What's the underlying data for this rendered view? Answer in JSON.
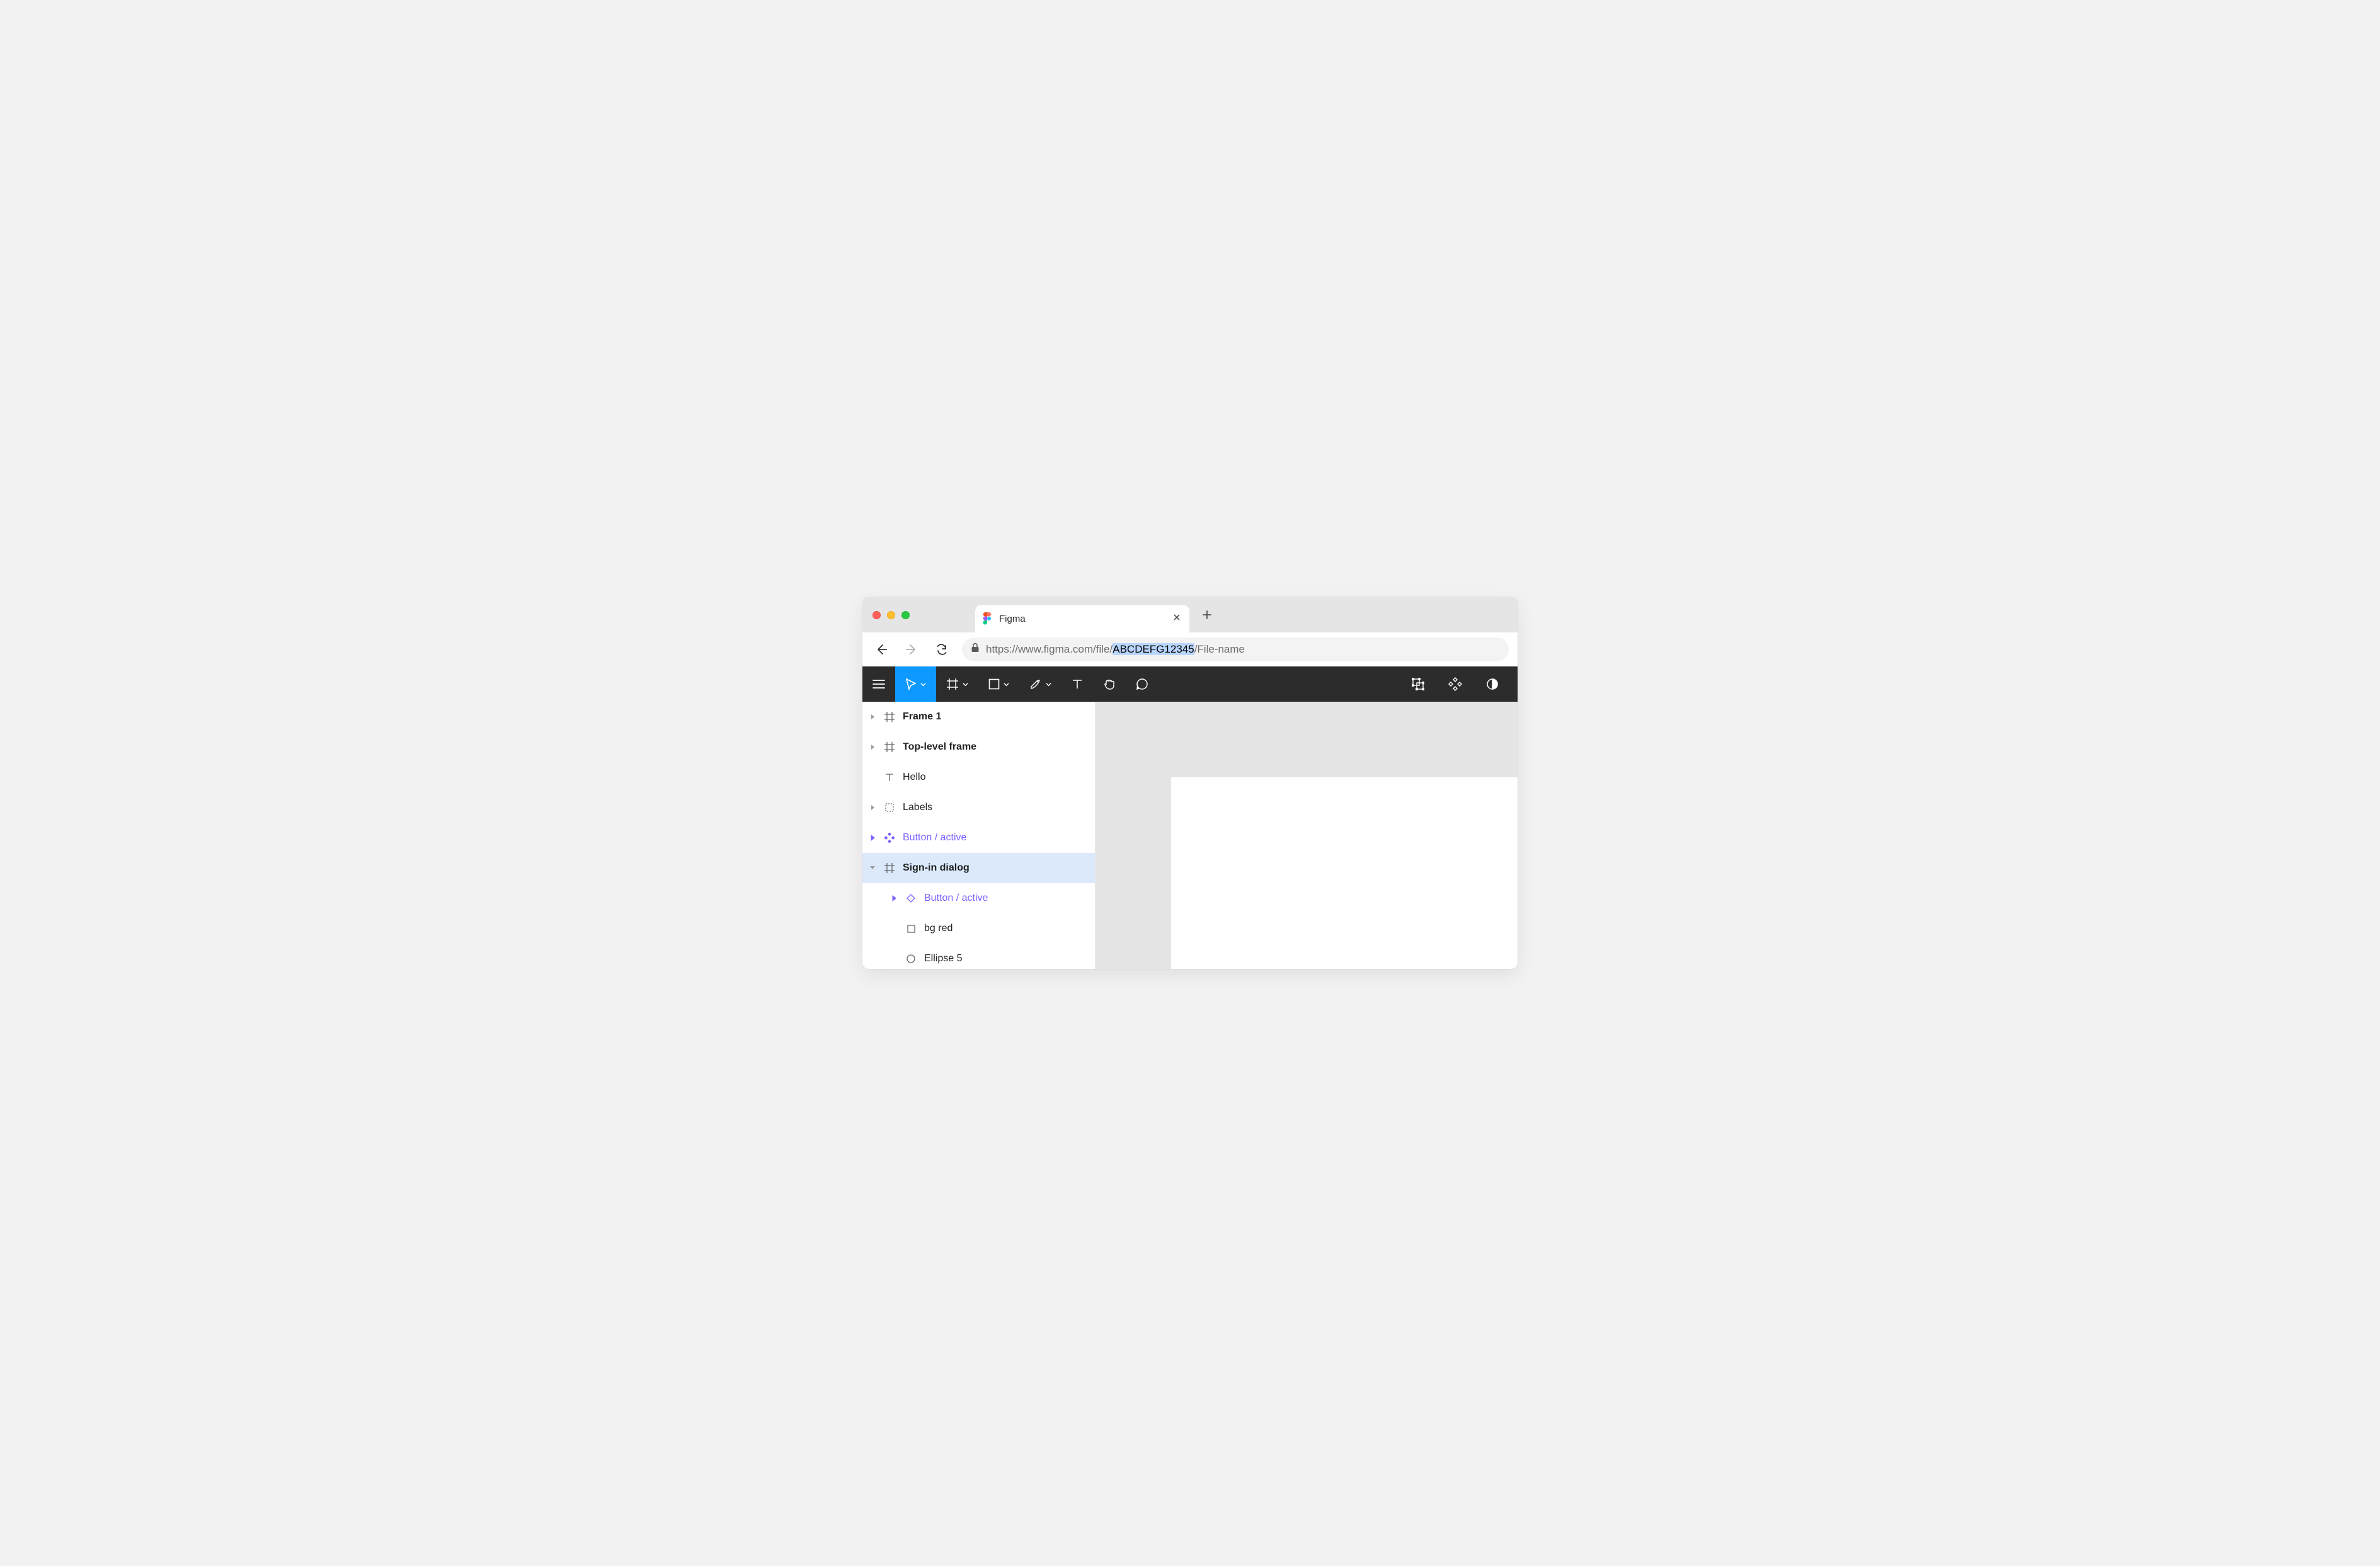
{
  "browser": {
    "tab_title": "Figma",
    "url_prefix": "https://www.figma.com/file/",
    "url_highlight": "ABCDEFG12345",
    "url_suffix": "/File-name"
  },
  "toolbar": {
    "items": [
      "menu",
      "move",
      "frame",
      "shape",
      "pen",
      "text",
      "hand",
      "comment"
    ],
    "right": [
      "mirror",
      "plugins",
      "darkmode"
    ]
  },
  "layers": [
    {
      "label": "Frame 1",
      "icon": "frame",
      "arrow": "right",
      "bold": true,
      "indent": 0
    },
    {
      "label": "Top-level frame",
      "icon": "frame",
      "arrow": "right",
      "bold": true,
      "indent": 0
    },
    {
      "label": "Hello",
      "icon": "text",
      "arrow": "none",
      "bold": false,
      "indent": 0
    },
    {
      "label": "Labels",
      "icon": "group",
      "arrow": "right",
      "bold": false,
      "indent": 0
    },
    {
      "label": "Button / active",
      "icon": "componentfill",
      "arrow": "right",
      "bold": false,
      "indent": 0,
      "purple": true
    },
    {
      "label": "Sign-in dialog",
      "icon": "frame",
      "arrow": "down",
      "bold": true,
      "indent": 0,
      "selected": true
    },
    {
      "label": "Button / active",
      "icon": "instance",
      "arrow": "right",
      "bold": false,
      "indent": 1,
      "purple": true
    },
    {
      "label": "bg red",
      "icon": "rect",
      "arrow": "none",
      "bold": false,
      "indent": 1
    },
    {
      "label": "Ellipse 5",
      "icon": "ellipse",
      "arrow": "none",
      "bold": false,
      "indent": 1
    }
  ]
}
